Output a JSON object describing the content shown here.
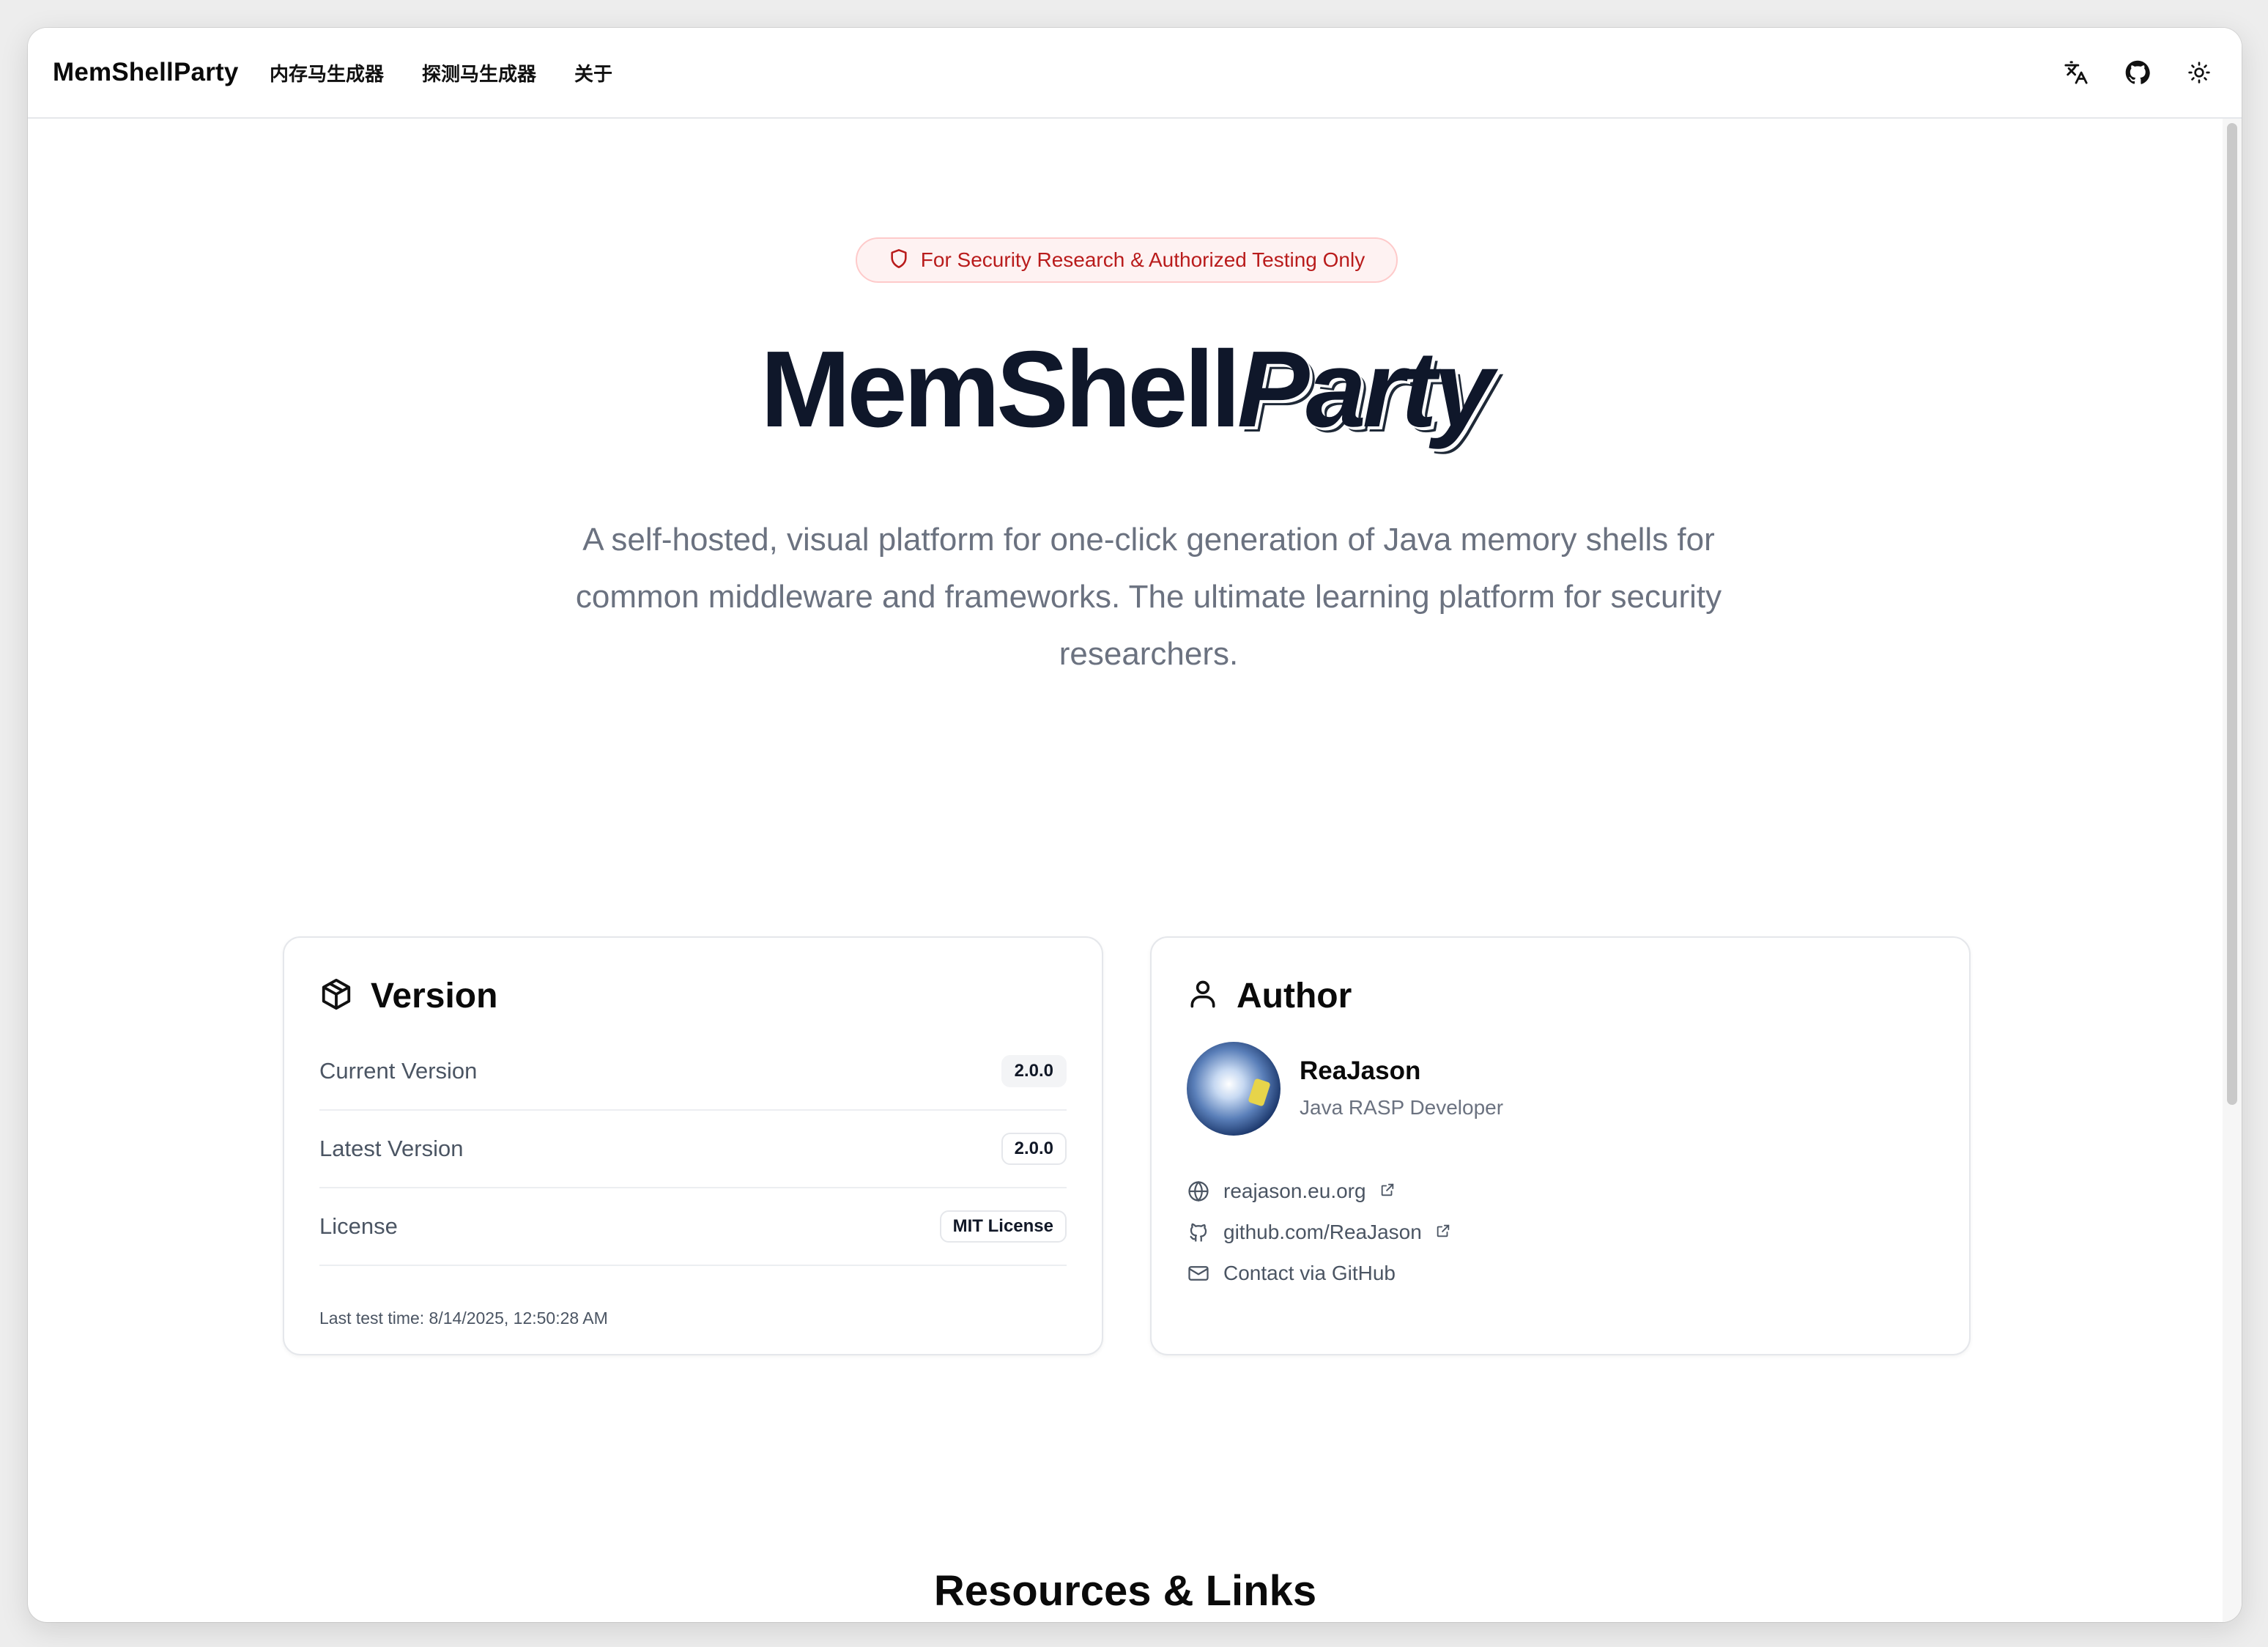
{
  "header": {
    "brand": "MemShellParty",
    "nav": [
      "内存马生成器",
      "探测马生成器",
      "关于"
    ],
    "icons": [
      "translate-icon",
      "github-icon",
      "sun-icon"
    ]
  },
  "hero": {
    "badge": "For Security Research & Authorized Testing Only",
    "title_main": "MemShell",
    "title_accent": "Party",
    "subtitle": "A self-hosted, visual platform for one-click generation of Java memory shells for common middleware and frameworks. The ultimate learning platform for security researchers."
  },
  "version_card": {
    "title": "Version",
    "rows": [
      {
        "label": "Current Version",
        "value": "2.0.0"
      },
      {
        "label": "Latest Version",
        "value": "2.0.0"
      },
      {
        "label": "License",
        "value": "MIT License"
      }
    ],
    "last_test": "Last test time: 8/14/2025, 12:50:28 AM"
  },
  "author_card": {
    "title": "Author",
    "name": "ReaJason",
    "role": "Java RASP Developer",
    "links": [
      {
        "text": "reajason.eu.org",
        "icon": "globe-icon",
        "external": true
      },
      {
        "text": "github.com/ReaJason",
        "icon": "github-icon",
        "external": true
      },
      {
        "text": "Contact via GitHub",
        "icon": "mail-icon",
        "external": false
      }
    ]
  },
  "resources": {
    "title": "Resources & Links"
  },
  "colors": {
    "badge_text": "#b91c1c",
    "badge_bg": "#fef2f2",
    "badge_border": "#fecaca",
    "title": "#0f172a",
    "muted": "#6b7280"
  }
}
